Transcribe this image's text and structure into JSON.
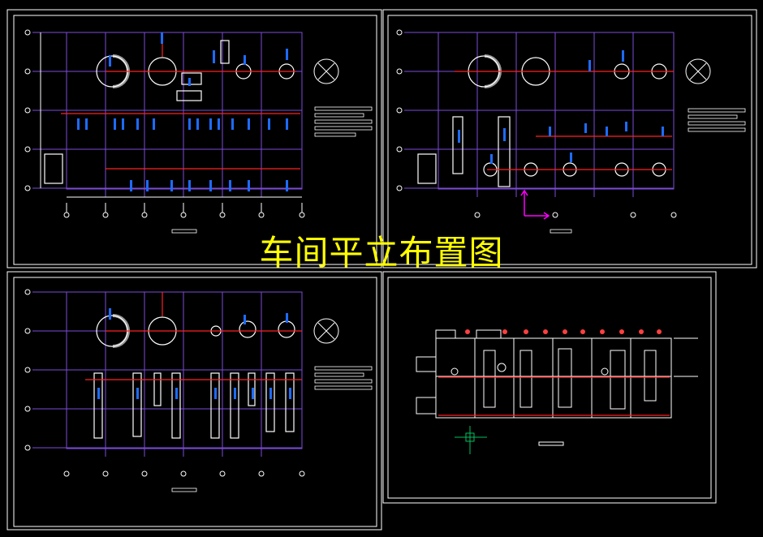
{
  "title": "车间平立布置图",
  "colors": {
    "background": "#000000",
    "frame": "#ffffff",
    "grid": "#7b4bd8",
    "pipe": "#ff2020",
    "equipment": "#ffffff",
    "valves": "#1e6bff",
    "title": "#ffff00",
    "axis": "#ff00ff",
    "cross": "#00c060"
  },
  "notes_icon": "north-arrow-icon"
}
